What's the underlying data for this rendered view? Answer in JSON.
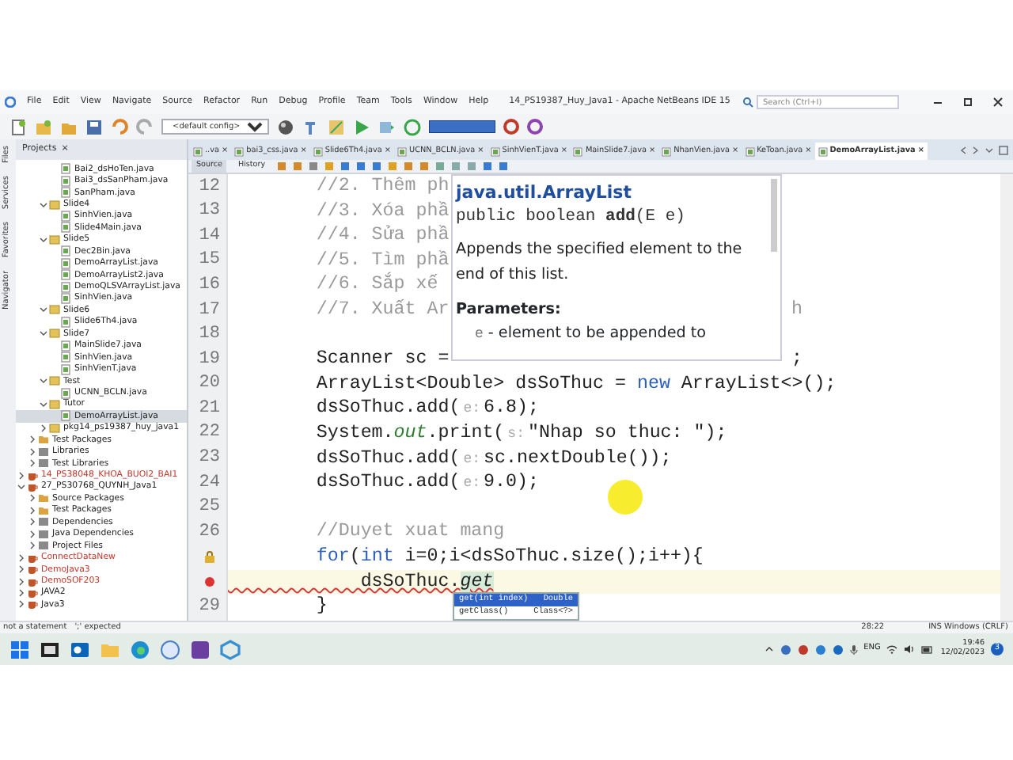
{
  "window": {
    "title": "14_PS19387_Huy_Java1 - Apache NetBeans IDE 15",
    "search_placeholder": "Search (Ctrl+I)"
  },
  "menu": [
    "File",
    "Edit",
    "View",
    "Navigate",
    "Source",
    "Refactor",
    "Run",
    "Debug",
    "Profile",
    "Team",
    "Tools",
    "Window",
    "Help"
  ],
  "toolbar": {
    "config": "<default config>"
  },
  "projects_panel": {
    "title": "Projects",
    "close": "×"
  },
  "side_tabs": [
    "Files",
    "Services",
    "Favorites",
    "Navigator"
  ],
  "tree": [
    {
      "children": [
        {
          "children": [
            {
              "children": [
                {
                  "label": "Bai2_dsHoTen.java",
                  "kind": "file",
                  "selected": false
                },
                {
                  "label": "Bai3_dsSanPham.java",
                  "kind": "file",
                  "selected": false
                },
                {
                  "label": "SanPham.java",
                  "kind": "file",
                  "selected": false
                }
              ]
            },
            {
              "label": "Slide4",
              "kind": "package",
              "expanded": true,
              "selected": false,
              "children": [
                {
                  "label": "SinhVien.java",
                  "kind": "file",
                  "selected": false
                },
                {
                  "label": "Slide4Main.java",
                  "kind": "file",
                  "selected": false
                }
              ]
            },
            {
              "label": "Slide5",
              "kind": "package",
              "expanded": true,
              "selected": false,
              "children": [
                {
                  "label": "Dec2Bin.java",
                  "kind": "file",
                  "selected": false
                },
                {
                  "label": "DemoArrayList.java",
                  "kind": "file",
                  "selected": false
                },
                {
                  "label": "DemoArrayList2.java",
                  "kind": "file",
                  "selected": false
                },
                {
                  "label": "DemoQLSVArrayList.java",
                  "kind": "file",
                  "selected": false
                },
                {
                  "label": "SinhVien.java",
                  "kind": "file",
                  "selected": false
                }
              ]
            },
            {
              "label": "Slide6",
              "kind": "package",
              "expanded": true,
              "selected": false,
              "children": [
                {
                  "label": "Slide6Th4.java",
                  "kind": "file",
                  "selected": false
                }
              ]
            },
            {
              "label": "Slide7",
              "kind": "package",
              "expanded": true,
              "selected": false,
              "children": [
                {
                  "label": "MainSlide7.java",
                  "kind": "file",
                  "selected": false
                },
                {
                  "label": "SinhVien.java",
                  "kind": "file",
                  "selected": false
                },
                {
                  "label": "SinhVienT.java",
                  "kind": "file",
                  "selected": false
                }
              ]
            },
            {
              "label": "Test",
              "kind": "package",
              "expanded": true,
              "selected": false,
              "children": [
                {
                  "label": "UCNN_BCLN.java",
                  "kind": "file",
                  "selected": false
                }
              ]
            },
            {
              "label": "Tutor",
              "kind": "package",
              "expanded": true,
              "selected": false,
              "children": [
                {
                  "label": "DemoArrayList.java",
                  "kind": "file",
                  "selected": true
                }
              ]
            },
            {
              "label": "pkg14_ps19387_huy_java1",
              "kind": "package",
              "expanded": false,
              "selected": false
            }
          ]
        },
        {
          "label": "Test Packages",
          "kind": "folder",
          "expanded": false,
          "selected": false
        },
        {
          "label": "Libraries",
          "kind": "library",
          "expanded": false,
          "selected": false
        },
        {
          "label": "Test Libraries",
          "kind": "library",
          "expanded": false,
          "selected": false
        }
      ]
    },
    {
      "label": "14_PS38048_KHOA_BUOI2_BAI1",
      "kind": "project",
      "expanded": false,
      "error": true,
      "selected": false
    },
    {
      "label": "27_PS30768_QUYNH_Java1",
      "kind": "project",
      "expanded": true,
      "error": false,
      "selected": false,
      "children": [
        {
          "label": "Source Packages",
          "kind": "folder",
          "expanded": false,
          "selected": false
        },
        {
          "label": "Test Packages",
          "kind": "folder",
          "expanded": false,
          "selected": false
        },
        {
          "label": "Dependencies",
          "kind": "library",
          "expanded": false,
          "selected": false
        },
        {
          "label": "Java Dependencies",
          "kind": "library",
          "expanded": false,
          "selected": false
        },
        {
          "label": "Project Files",
          "kind": "library",
          "expanded": false,
          "selected": false
        }
      ]
    },
    {
      "label": "ConnectDataNew",
      "kind": "project",
      "expanded": false,
      "error": true,
      "selected": false
    },
    {
      "label": "DemoJava3",
      "kind": "project",
      "expanded": false,
      "error": true,
      "selected": false
    },
    {
      "label": "DemoSOF203",
      "kind": "project",
      "expanded": false,
      "error": true,
      "selected": false
    },
    {
      "label": "JAVA2",
      "kind": "project",
      "expanded": false,
      "error": false,
      "selected": false
    },
    {
      "label": "Java3",
      "kind": "project",
      "expanded": false,
      "error": false,
      "selected": false
    }
  ],
  "editor_tabs": [
    {
      "label": "..va",
      "close": "×",
      "selected": false
    },
    {
      "label": "bai3_css.java",
      "close": "×",
      "selected": false
    },
    {
      "label": "Slide6Th4.java",
      "close": "×",
      "selected": false
    },
    {
      "label": "UCNN_BCLN.java",
      "close": "×",
      "selected": false
    },
    {
      "label": "SinhVienT.java",
      "close": "×",
      "selected": false
    },
    {
      "label": "MainSlide7.java",
      "close": "×",
      "selected": false
    },
    {
      "label": "NhanVien.java",
      "close": "×",
      "selected": false
    },
    {
      "label": "KeToan.java",
      "close": "×",
      "selected": false
    },
    {
      "label": "DemoArrayList.java",
      "close": "×",
      "selected": true
    }
  ],
  "editor_toolbar": [
    {
      "label": "Source",
      "selected": true
    },
    {
      "label": "History",
      "selected": false
    }
  ],
  "code_lines": [
    {
      "number": "12",
      "segments": [
        {
          "text": "        //2. Thêm ph",
          "kind": "comment"
        }
      ]
    },
    {
      "number": "13",
      "segments": [
        {
          "text": "        //3. Xóa phầ",
          "kind": "comment"
        }
      ]
    },
    {
      "number": "14",
      "segments": [
        {
          "text": "        //4. Sửa phầ",
          "kind": "comment"
        }
      ]
    },
    {
      "number": "15",
      "segments": [
        {
          "text": "        //5. Tìm phầ",
          "kind": "comment"
        }
      ]
    },
    {
      "number": "16",
      "segments": [
        {
          "text": "        //6. Sắp xế",
          "kind": "comment"
        }
      ]
    },
    {
      "number": "17",
      "segments": [
        {
          "text": "        //7. Xuất Ar",
          "kind": "comment"
        }
      ],
      "tail": {
        "text": "h",
        "kind": "comment"
      }
    },
    {
      "number": "18"
    },
    {
      "number": "19",
      "segments": [
        {
          "text": "        Scanner sc =",
          "kind": "plain"
        }
      ],
      "tail": {
        "text": ";",
        "kind": "plain"
      }
    },
    {
      "number": "20",
      "segments": [
        {
          "text": "        ArrayList<Double> dsSoThuc = ",
          "kind": "plain"
        },
        {
          "text": "new",
          "kind": "keyword"
        },
        {
          "text": " ArrayList<>();",
          "kind": "plain"
        }
      ]
    },
    {
      "number": "21",
      "segments": [
        {
          "text": "        dsSoThuc.add(",
          "kind": "plain"
        },
        {
          "text": "e:",
          "kind": "hint"
        },
        {
          "text": "6.8);",
          "kind": "plain"
        }
      ]
    },
    {
      "number": "22",
      "segments": [
        {
          "text": "        System.",
          "kind": "plain"
        },
        {
          "text": "out",
          "kind": "field"
        },
        {
          "text": ".print(",
          "kind": "plain"
        },
        {
          "text": "s:",
          "kind": "hint"
        },
        {
          "text": "\"Nhap so thuc: \");",
          "kind": "plain"
        }
      ]
    },
    {
      "number": "23",
      "segments": [
        {
          "text": "        dsSoThuc.add(",
          "kind": "plain"
        },
        {
          "text": "e:",
          "kind": "hint"
        },
        {
          "text": "sc.nextDouble());",
          "kind": "plain"
        }
      ]
    },
    {
      "number": "24",
      "segments": [
        {
          "text": "        dsSoThuc.add(",
          "kind": "plain"
        },
        {
          "text": "e:",
          "kind": "hint"
        },
        {
          "text": "9.0);",
          "kind": "plain"
        }
      ]
    },
    {
      "number": "25"
    },
    {
      "number": "26",
      "segments": [
        {
          "text": "        //Duyet xuat mang",
          "kind": "comment"
        }
      ]
    },
    {
      "warning": true,
      "error": false,
      "segments": [
        {
          "text": "        for",
          "kind": "keyword"
        },
        {
          "text": "(",
          "kind": "plain"
        },
        {
          "text": "int",
          "kind": "keyword"
        },
        {
          "text": " i=0;i<dsSoThuc.size();i++){",
          "kind": "plain"
        }
      ]
    },
    {
      "warning": false,
      "error": true,
      "current": true,
      "segments": [
        {
          "text": "            dsSoThuc.",
          "kind": "plain"
        },
        {
          "text": "get",
          "kind": "match"
        }
      ]
    },
    {
      "number": "29",
      "segments": [
        {
          "text": "        }",
          "kind": "plain"
        }
      ]
    }
  ],
  "tooltip": {
    "title": "java.util.ArrayList",
    "signature": "public boolean **add**(E e)",
    "description": "Appends the specified element to the end of this list.",
    "params_heading": "Parameters:",
    "param_name": "e",
    "param_text": "- element to be appended to"
  },
  "completion": [
    {
      "name": "get(int index)",
      "type": "Double",
      "selected": true
    },
    {
      "name": "getClass()",
      "type": "Class<?>",
      "selected": false
    }
  ],
  "status_bar": {
    "message": "not a statement",
    "detail": "';' expected",
    "position": "28:22",
    "mode": "INS Windows (CRLF)"
  },
  "taskbar": {
    "language": "ENG",
    "time": "19:46",
    "date": "12/02/2023",
    "notifications": "3"
  }
}
